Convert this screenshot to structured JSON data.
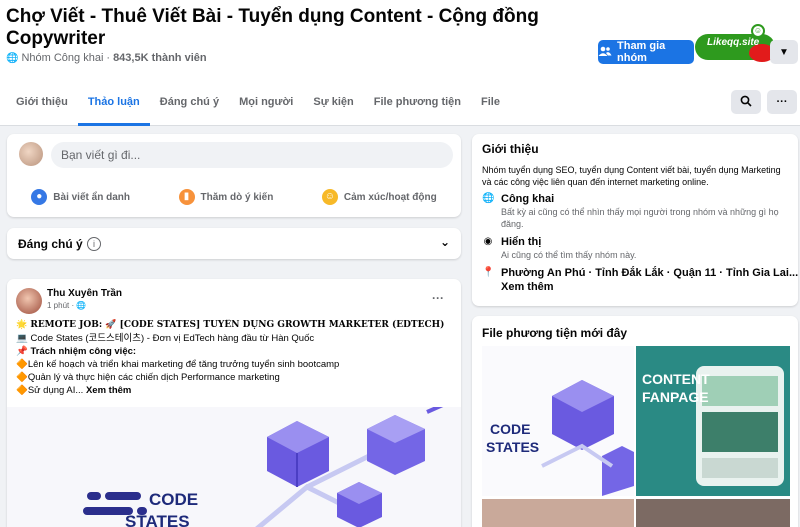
{
  "header": {
    "title": "Chợ Viết - Thuê Viết Bài - Tuyển dụng Content - Cộng đồng Copywriter",
    "privacy": "Nhóm Công khai",
    "separator": "·",
    "members": "843,5K thành viên",
    "join_label": "Tham gia nhóm",
    "watermark": "Likeqq.site"
  },
  "tabs": [
    {
      "label": "Giới thiệu"
    },
    {
      "label": "Thảo luận",
      "active": true
    },
    {
      "label": "Đáng chú ý"
    },
    {
      "label": "Mọi người"
    },
    {
      "label": "Sự kiện"
    },
    {
      "label": "File phương tiện"
    },
    {
      "label": "File"
    }
  ],
  "composer": {
    "placeholder": "Bạn viết gì đi...",
    "actions": [
      {
        "label": "Bài viết ẩn danh",
        "icon": "incognito-icon",
        "color": "#3578e5"
      },
      {
        "label": "Thăm dò ý kiến",
        "icon": "poll-icon",
        "color": "#f7923b"
      },
      {
        "label": "Cảm xúc/hoạt động",
        "icon": "smiley-icon",
        "color": "#f7b928"
      }
    ]
  },
  "featured": {
    "label": "Đáng chú ý"
  },
  "post": {
    "author": "Thu Xuyên Trần",
    "time": "1 phút ·",
    "lines": [
      "🌟 REMOTE JOB: 🚀 [CODE STATES] TUYỂN DỤNG GROWTH MARKETER (EDTECH)",
      "💻 Code States (코드스테이츠) - Đơn vị EdTech hàng đầu từ Hàn Quốc",
      "📌 Trách nhiệm công việc:",
      "🔶Lên kế hoạch và triển khai marketing để tăng trưởng tuyển sinh bootcamp",
      "🔶Quản lý và thực hiện các chiến dịch Performance marketing",
      "🔶Sử dụng AI... "
    ],
    "see_more": "Xem thêm",
    "image_text": [
      "CODE",
      "STATES"
    ]
  },
  "about": {
    "title": "Giới thiệu",
    "description": "Nhóm tuyển dụng SEO, tuyển dụng Content viết bài, tuyển dụng Marketing và các công việc liên quan đến internet marketing online.",
    "public_title": "Công khai",
    "public_desc": "Bất kỳ ai cũng có thể nhìn thấy mọi người trong nhóm và những gì họ đăng.",
    "visible_title": "Hiển thị",
    "visible_desc": "Ai cũng có thể tìm thấy nhóm này.",
    "location": "Phường An Phú · Tỉnh Đắk Lắk · Quận 11 · Tỉnh Gia Lai...",
    "see_more": "Xem thêm"
  },
  "media": {
    "title": "File phương tiện mới đây",
    "thumb_text": [
      "CODE",
      "STATES"
    ],
    "thumb2_text": [
      "CONTENT",
      "FANPAGE"
    ]
  },
  "colors": {
    "accent": "#1b74e4",
    "background": "#f0f2f5"
  }
}
